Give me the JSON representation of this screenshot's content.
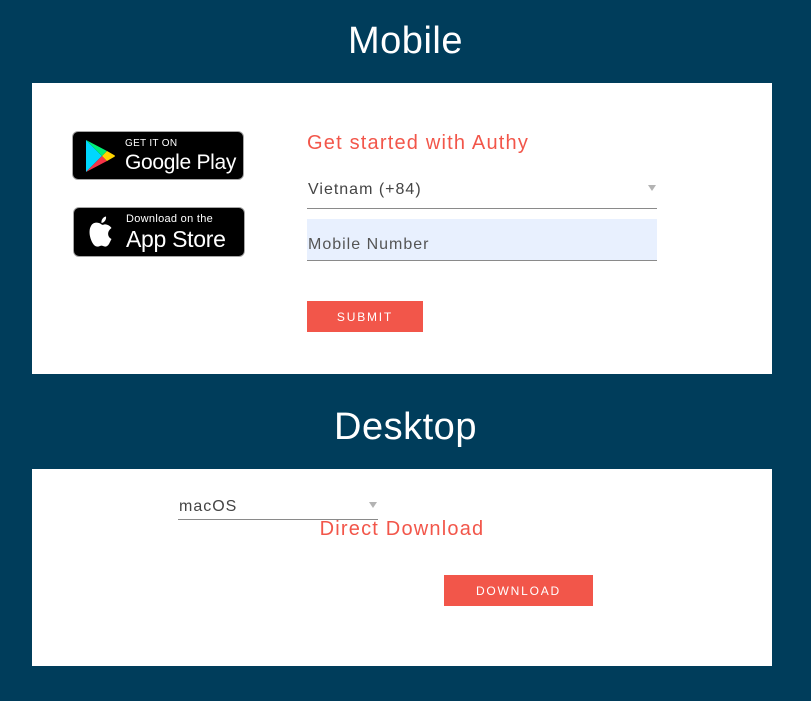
{
  "mobile": {
    "title": "Mobile",
    "google_play": {
      "small": "GET IT ON",
      "big": "Google Play",
      "icon": "google-play-icon"
    },
    "app_store": {
      "small": "Download on the",
      "big": "App Store",
      "icon": "apple-icon"
    },
    "form": {
      "heading": "Get started with Authy",
      "country_value": "Vietnam (+84)",
      "mobile_placeholder": "Mobile Number",
      "submit_label": "SUBMIT"
    }
  },
  "desktop": {
    "title": "Desktop",
    "heading": "Direct Download",
    "os_value": "macOS",
    "download_label": "DOWNLOAD"
  },
  "colors": {
    "background": "#003d5b",
    "accent": "#f2564a",
    "card": "#ffffff",
    "input_fill": "#e8f0fe"
  }
}
